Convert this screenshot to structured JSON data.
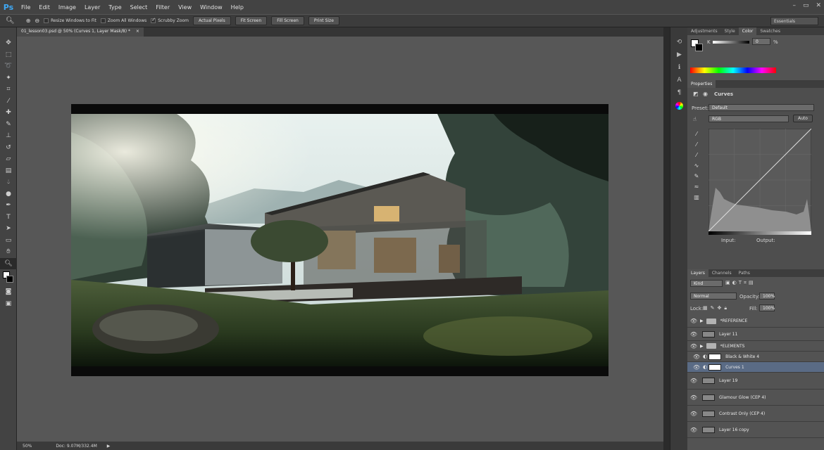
{
  "app_logo": "Ps",
  "menu": [
    "File",
    "Edit",
    "Image",
    "Layer",
    "Type",
    "Select",
    "Filter",
    "View",
    "Window",
    "Help"
  ],
  "window_controls": [
    "–",
    "▭",
    "✕"
  ],
  "options": {
    "resize_windows": "Resize Windows to Fit",
    "zoom_all": "Zoom All Windows",
    "scrubby": "Scrubby Zoom",
    "actual_pixels": "Actual Pixels",
    "fit_screen": "Fit Screen",
    "fill_screen": "Fill Screen",
    "print_size": "Print Size",
    "workspace": "Essentials"
  },
  "document": {
    "tab_title": "01_lesson03.psd @ 50% (Curves 1, Layer Mask/8) *",
    "zoom": "50%",
    "doc_info": "Doc: 9.07M/332.4M"
  },
  "panels": {
    "top_tabs": [
      "Adjustments",
      "Style",
      "Color",
      "Swatches"
    ],
    "color_channel": "K",
    "color_value": "0",
    "color_unit": "%",
    "properties_tab": "Properties",
    "properties_title": "Curves",
    "preset_label": "Preset:",
    "preset_value": "Default",
    "channel_value": "RGB",
    "auto_label": "Auto",
    "input_label": "Input:",
    "output_label": "Output:",
    "layer_tabs": [
      "Layers",
      "Channels",
      "Paths"
    ],
    "kind_label": "Kind",
    "blend_mode": "Normal",
    "opacity_label": "Opacity:",
    "opacity_value": "100%",
    "lock_label": "Lock:",
    "fill_label": "Fill:",
    "fill_value": "100%"
  },
  "layers": [
    {
      "name": "*REFERENCE",
      "type": "folder"
    },
    {
      "name": "Layer 11",
      "type": "layer"
    },
    {
      "name": "*ELEMENTS",
      "type": "folder"
    },
    {
      "name": "Black & White 4",
      "type": "adjust"
    },
    {
      "name": "Curves 1",
      "type": "adjust",
      "selected": true
    },
    {
      "name": "Layer 19",
      "type": "layer"
    },
    {
      "name": "Glamour Glow (CEP 4)",
      "type": "layer"
    },
    {
      "name": "Contrast Only (CEP 4)",
      "type": "layer"
    },
    {
      "name": "Layer 16 copy",
      "type": "layer"
    }
  ],
  "colors": {
    "accent": "#3fa9f5",
    "selected_layer": "#5a6b85"
  }
}
